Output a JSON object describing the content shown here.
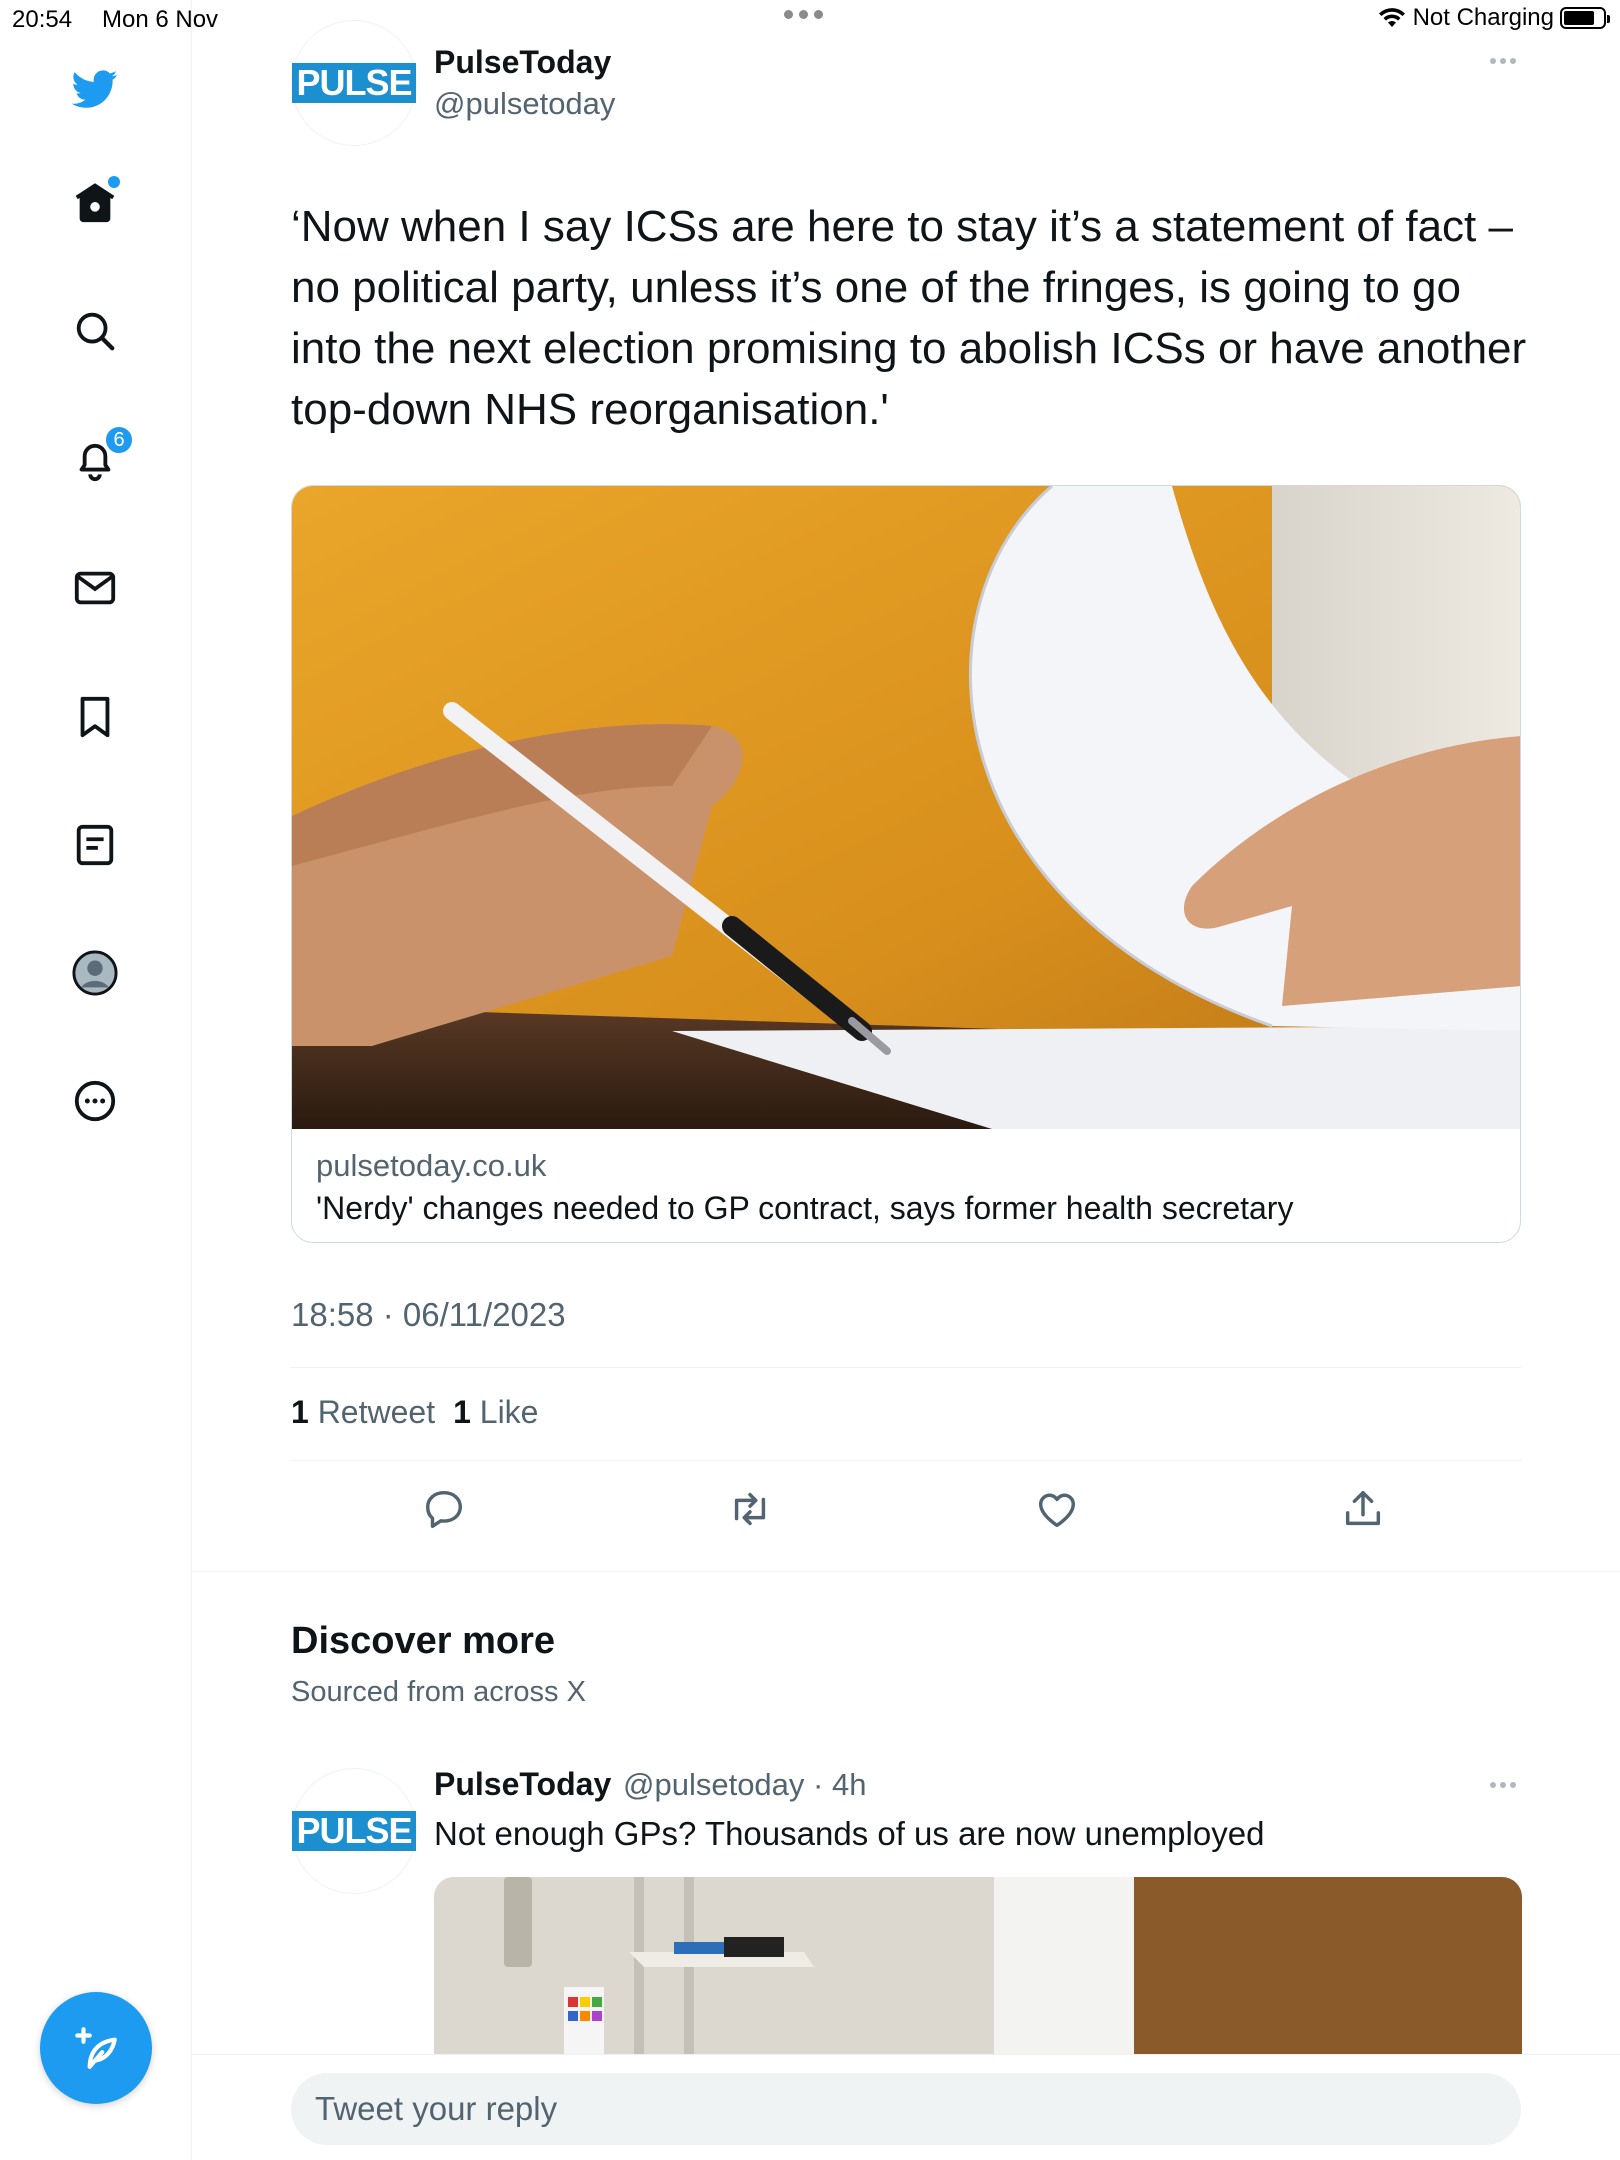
{
  "status_bar": {
    "time": "20:54",
    "date": "Mon 6 Nov",
    "charging": "Not Charging"
  },
  "sidebar": {
    "notifications_count": "6",
    "accent": "#1d9bf0",
    "icons": [
      "twitter-bird-icon",
      "home-icon",
      "search-icon",
      "bell-icon",
      "mail-icon",
      "bookmark-icon",
      "lists-icon",
      "profile-icon",
      "more-circle-icon",
      "compose-icon"
    ]
  },
  "tweet": {
    "author_logo": "PULSE",
    "author_name": "PulseToday",
    "author_handle": "@pulsetoday",
    "text": "‘Now when I say ICSs are here to stay it’s a statement of fact – no political party, unless it’s one of the fringes, is going to go into the next election promising to abolish ICSs or have another top-down NHS reorganisation.'",
    "card": {
      "domain": "pulsetoday.co.uk",
      "title": "'Nerdy' changes needed to GP contract, says former health secretary"
    },
    "timestamp": "18:58 · 06/11/2023",
    "retweets_count": "1",
    "retweets_label": "Retweet",
    "likes_count": "1",
    "likes_label": "Like"
  },
  "discover": {
    "title": "Discover more",
    "subtitle": "Sourced from across X"
  },
  "tweet2": {
    "author_logo": "PULSE",
    "author_name": "PulseToday",
    "meta": "@pulsetoday · 4h",
    "text": "Not enough GPs? Thousands of us are now unemployed"
  },
  "reply": {
    "placeholder": "Tweet your reply"
  }
}
